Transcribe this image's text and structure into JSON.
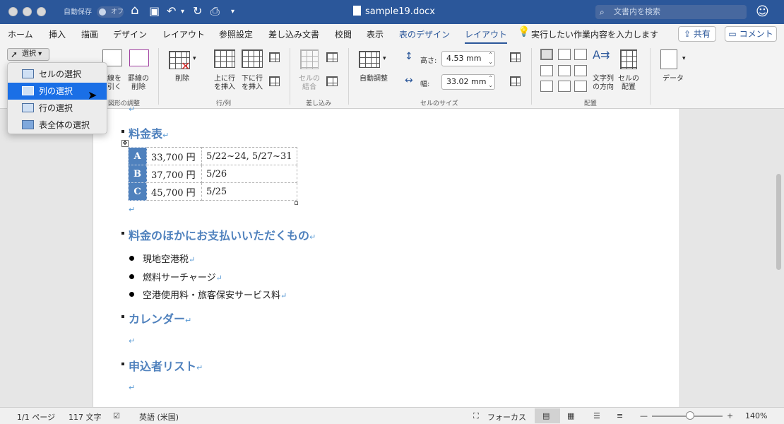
{
  "titlebar": {
    "autosave_label": "自動保存",
    "autosave_state": "オフ",
    "doc_title": "sample19.docx",
    "search_placeholder": "文書内を検索"
  },
  "tabs": [
    "ホーム",
    "挿入",
    "描画",
    "デザイン",
    "レイアウト",
    "参照設定",
    "差し込み文書",
    "校閲",
    "表示",
    "表のデザイン",
    "レイアウト"
  ],
  "tell_me": "実行したい作業内容を入力します",
  "share_label": "共有",
  "comment_label": "コメント",
  "ribbon": {
    "select_label": "選択",
    "draw_label": "線を\n引く",
    "erase_label": "罫線の\n削除",
    "group_draw": "図形の調整",
    "delete_label": "削除",
    "insert_above": "上に行\nを挿入",
    "insert_below": "下に行\nを挿入",
    "group_rowcol": "行/列",
    "merge_cells": "セルの\n結合",
    "group_merge": "差し込み",
    "autofit": "自動調整",
    "height_label": "高さ:",
    "height_value": "4.53 mm",
    "width_label": "幅:",
    "width_value": "33.02 mm",
    "group_size": "セルのサイズ",
    "text_direction": "文字列\nの方向",
    "cell_margins": "セルの\n配置",
    "group_align": "配置",
    "data_label": "データ"
  },
  "menu": {
    "items": [
      "セルの選択",
      "列の選択",
      "行の選択",
      "表全体の選択"
    ],
    "active_index": 1
  },
  "document": {
    "h1": "料金表",
    "table": [
      [
        "A",
        "33,700 円",
        "5/22~24, 5/27~31"
      ],
      [
        "B",
        "37,700 円",
        "5/26"
      ],
      [
        "C",
        "45,700 円",
        "5/25"
      ]
    ],
    "h2": "料金のほかにお支払いいただくもの",
    "list": [
      "現地空港税",
      "燃料サーチャージ",
      "空港使用料・旅客保安サービス料"
    ],
    "h3": "カレンダー",
    "h4": "申込者リスト",
    "para_mark": "↵"
  },
  "status": {
    "page": "1/1 ページ",
    "words": "117 文字",
    "language": "英語 (米国)",
    "focus": "フォーカス",
    "zoom": "140%"
  },
  "colors": {
    "titlebar": "#2b579a",
    "heading": "#4f81bd",
    "menu_active": "#1a6fe6",
    "table_header": "#4f81bd"
  }
}
